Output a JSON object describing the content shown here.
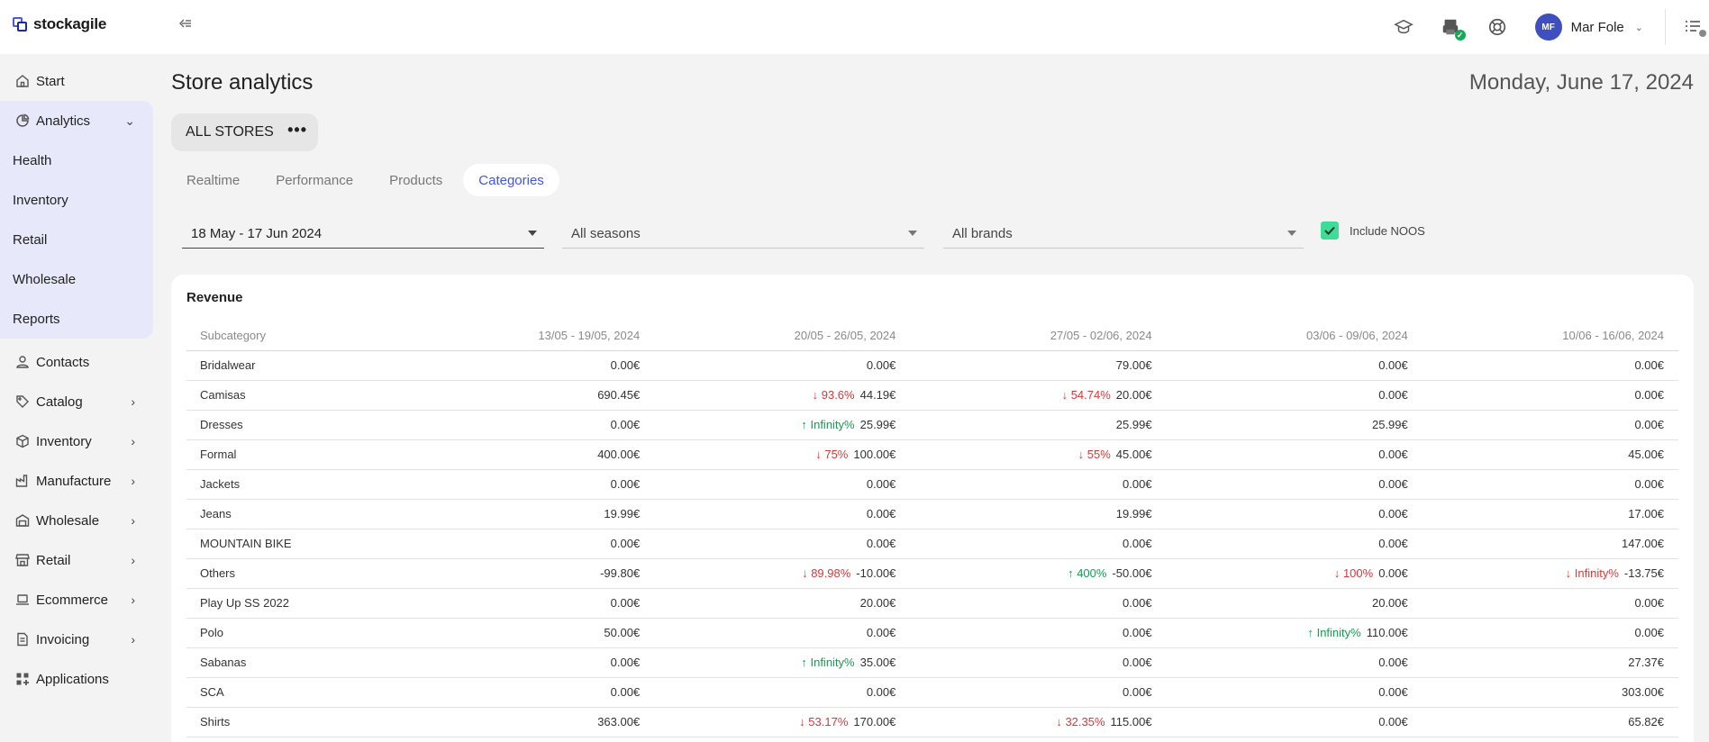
{
  "app": {
    "name": "stockagile"
  },
  "user": {
    "initials": "MF",
    "name": "Mar Fole"
  },
  "sidebar": {
    "start": "Start",
    "analytics": {
      "label": "Analytics",
      "items": [
        "Health",
        "Inventory",
        "Retail",
        "Wholesale",
        "Reports"
      ]
    },
    "items": [
      "Contacts",
      "Catalog",
      "Inventory",
      "Manufacture",
      "Wholesale",
      "Retail",
      "Ecommerce",
      "Invoicing",
      "Applications"
    ]
  },
  "page": {
    "title": "Store analytics",
    "date": "Monday, June 17, 2024"
  },
  "store_selector": "ALL STORES",
  "tabs": [
    "Realtime",
    "Performance",
    "Products",
    "Categories"
  ],
  "filters": {
    "date_range": "18 May - 17 Jun 2024",
    "seasons": "All seasons",
    "brands": "All brands",
    "include_noos": "Include NOOS"
  },
  "revenue": {
    "title": "Revenue",
    "columns": [
      "Subcategory",
      "13/05 - 19/05, 2024",
      "20/05 - 26/05, 2024",
      "27/05 - 02/06, 2024",
      "03/06 - 09/06, 2024",
      "10/06 - 16/06, 2024"
    ],
    "rows": [
      {
        "name": "Bridalwear",
        "cells": [
          {
            "v": "0.00€"
          },
          {
            "v": "0.00€"
          },
          {
            "v": "79.00€"
          },
          {
            "v": "0.00€"
          },
          {
            "v": "0.00€"
          }
        ]
      },
      {
        "name": "Camisas",
        "cells": [
          {
            "v": "690.45€"
          },
          {
            "v": "44.19€",
            "c": "↓ 93.6%",
            "d": "down"
          },
          {
            "v": "20.00€",
            "c": "↓ 54.74%",
            "d": "down"
          },
          {
            "v": "0.00€"
          },
          {
            "v": "0.00€"
          }
        ]
      },
      {
        "name": "Dresses",
        "cells": [
          {
            "v": "0.00€"
          },
          {
            "v": "25.99€",
            "c": "↑ Infinity%",
            "d": "up"
          },
          {
            "v": "25.99€"
          },
          {
            "v": "25.99€"
          },
          {
            "v": "0.00€"
          }
        ]
      },
      {
        "name": "Formal",
        "cells": [
          {
            "v": "400.00€"
          },
          {
            "v": "100.00€",
            "c": "↓ 75%",
            "d": "down"
          },
          {
            "v": "45.00€",
            "c": "↓ 55%",
            "d": "down"
          },
          {
            "v": "0.00€"
          },
          {
            "v": "45.00€"
          }
        ]
      },
      {
        "name": "Jackets",
        "cells": [
          {
            "v": "0.00€"
          },
          {
            "v": "0.00€"
          },
          {
            "v": "0.00€"
          },
          {
            "v": "0.00€"
          },
          {
            "v": "0.00€"
          }
        ]
      },
      {
        "name": "Jeans",
        "cells": [
          {
            "v": "19.99€"
          },
          {
            "v": "0.00€"
          },
          {
            "v": "19.99€"
          },
          {
            "v": "0.00€"
          },
          {
            "v": "17.00€"
          }
        ]
      },
      {
        "name": "MOUNTAIN BIKE",
        "cells": [
          {
            "v": "0.00€"
          },
          {
            "v": "0.00€"
          },
          {
            "v": "0.00€"
          },
          {
            "v": "0.00€"
          },
          {
            "v": "147.00€"
          }
        ]
      },
      {
        "name": "Others",
        "cells": [
          {
            "v": "-99.80€"
          },
          {
            "v": "-10.00€",
            "c": "↓ 89.98%",
            "d": "down"
          },
          {
            "v": "-50.00€",
            "c": "↑ 400%",
            "d": "up"
          },
          {
            "v": "0.00€",
            "c": "↓ 100%",
            "d": "down"
          },
          {
            "v": "-13.75€",
            "c": "↓ Infinity%",
            "d": "down"
          }
        ]
      },
      {
        "name": "Play Up SS 2022",
        "cells": [
          {
            "v": "0.00€"
          },
          {
            "v": "20.00€"
          },
          {
            "v": "0.00€"
          },
          {
            "v": "20.00€"
          },
          {
            "v": "0.00€"
          }
        ]
      },
      {
        "name": "Polo",
        "cells": [
          {
            "v": "50.00€"
          },
          {
            "v": "0.00€"
          },
          {
            "v": "0.00€"
          },
          {
            "v": "110.00€",
            "c": "↑ Infinity%",
            "d": "up"
          },
          {
            "v": "0.00€"
          }
        ]
      },
      {
        "name": "Sabanas",
        "cells": [
          {
            "v": "0.00€"
          },
          {
            "v": "35.00€",
            "c": "↑ Infinity%",
            "d": "up"
          },
          {
            "v": "0.00€"
          },
          {
            "v": "0.00€"
          },
          {
            "v": "27.37€"
          }
        ]
      },
      {
        "name": "SCA",
        "cells": [
          {
            "v": "0.00€"
          },
          {
            "v": "0.00€"
          },
          {
            "v": "0.00€"
          },
          {
            "v": "0.00€"
          },
          {
            "v": "303.00€"
          }
        ]
      },
      {
        "name": "Shirts",
        "cells": [
          {
            "v": "363.00€"
          },
          {
            "v": "170.00€",
            "c": "↓ 53.17%",
            "d": "down"
          },
          {
            "v": "115.00€",
            "c": "↓ 32.35%",
            "d": "down"
          },
          {
            "v": "0.00€"
          },
          {
            "v": "65.82€"
          }
        ]
      }
    ]
  }
}
